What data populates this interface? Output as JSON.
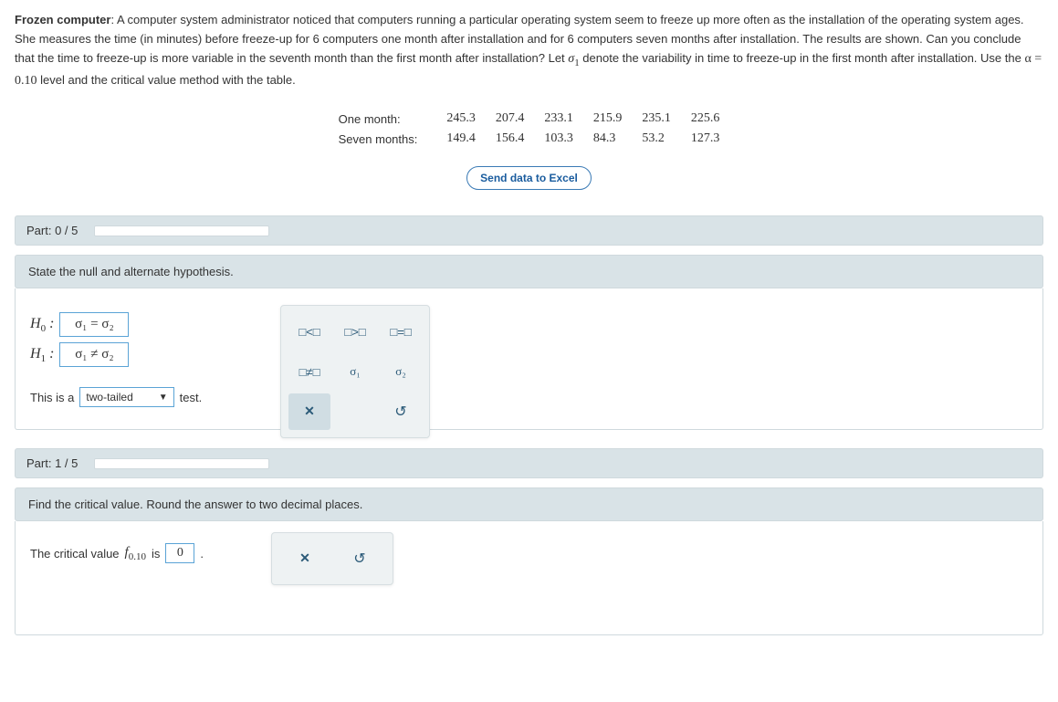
{
  "problem": {
    "title": "Frozen computer",
    "body_html": ": A computer system administrator noticed that computers running a particular operating system seem to freeze up more often as the installation of the operating system ages. She measures the time (in minutes) before freeze-up for 6 computers one month after installation and for 6 computers seven months after installation. The results are shown. Can you conclude that the time to freeze-up is more variable in the seventh month than the first month after installation? Let ",
    "sigma1": "σ",
    "sigma1_sub": "1",
    "body2": " denote the variability in time to freeze-up in the first month after installation. Use the ",
    "alpha_expr": "α = 0.10",
    "body3": " level and the critical value method with the table."
  },
  "data_table": {
    "rows": [
      {
        "label": "One month:",
        "values": [
          "245.3",
          "207.4",
          "233.1",
          "215.9",
          "235.1",
          "225.6"
        ]
      },
      {
        "label": "Seven months:",
        "values": [
          "149.4",
          "156.4",
          "103.3",
          "84.3",
          "53.2",
          "127.3"
        ]
      }
    ]
  },
  "excel_button": "Send data to Excel",
  "parts": {
    "p0": {
      "header": "Part: 0 / 5",
      "progress_pct": 0,
      "sub": "State the null and alternate hypothesis.",
      "h0_label": "H",
      "h0_sub": "0",
      "h0_colon": " :",
      "h0_value": "σ₁ = σ₂",
      "h1_label": "H",
      "h1_sub": "1",
      "h1_colon": " :",
      "h1_value": "σ₁ ≠ σ₂",
      "tail_pre": "This is a ",
      "tail_value": "two-tailed",
      "tail_post": " test."
    },
    "p1": {
      "header": "Part: 1 / 5",
      "progress_pct": 20,
      "sub": "Find the critical value. Round the answer to two decimal places.",
      "crit_pre": "The critical value ",
      "crit_f": "f",
      "crit_fsub": "0.10",
      "crit_is": " is ",
      "crit_value": "0",
      "crit_post": "."
    }
  },
  "palette1": {
    "r1": [
      "□<□",
      "□>□",
      "□=□"
    ],
    "r2": [
      "□≠□",
      "σ₁",
      "σ₂"
    ],
    "clear": "✕",
    "reset": "↺"
  },
  "palette2": {
    "clear": "✕",
    "reset": "↺"
  }
}
